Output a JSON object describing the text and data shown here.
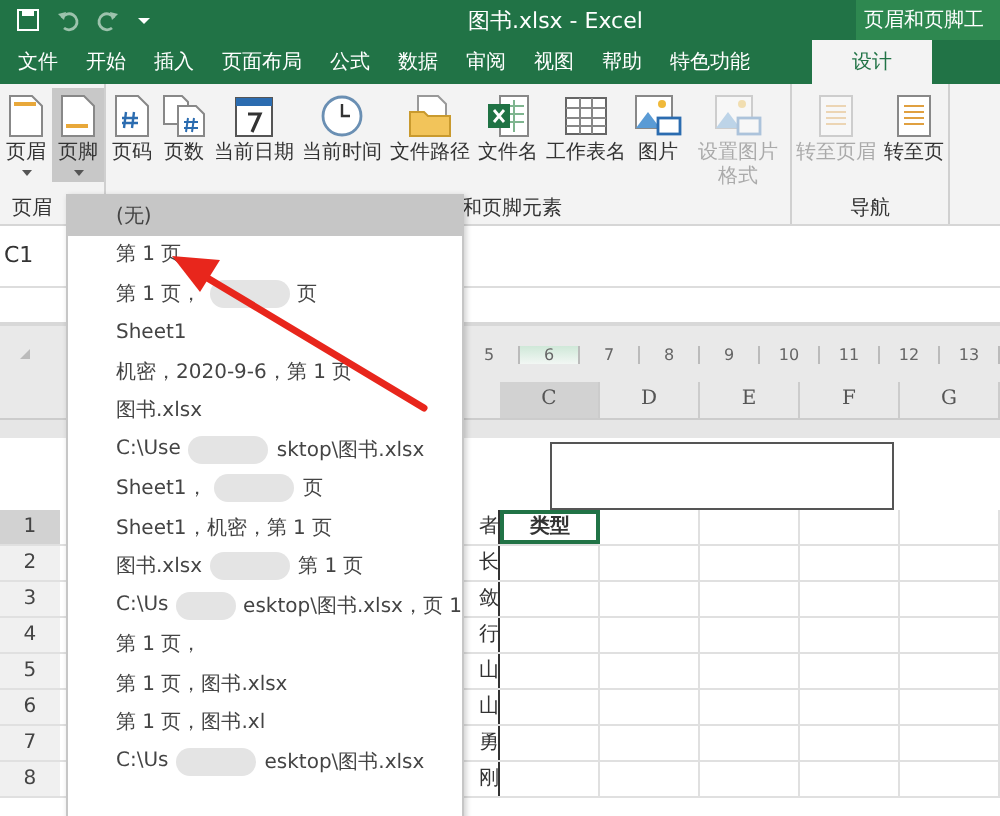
{
  "window": {
    "title": "图书.xlsx - Excel",
    "context_tab_group": "页眉和页脚工"
  },
  "tabs": [
    {
      "label": "文件",
      "selected": false
    },
    {
      "label": "开始",
      "selected": false
    },
    {
      "label": "插入",
      "selected": false
    },
    {
      "label": "页面布局",
      "selected": false
    },
    {
      "label": "公式",
      "selected": false
    },
    {
      "label": "数据",
      "selected": false
    },
    {
      "label": "审阅",
      "selected": false
    },
    {
      "label": "视图",
      "selected": false
    },
    {
      "label": "帮助",
      "selected": false
    },
    {
      "label": "特色功能",
      "selected": false
    },
    {
      "label": "设计",
      "selected": true
    }
  ],
  "ribbon": {
    "groups": [
      {
        "label": "页眉",
        "tools": [
          {
            "kind": "page",
            "label": "页眉",
            "pressed": false,
            "disabled": false
          },
          {
            "kind": "page",
            "label": "页脚",
            "pressed": true,
            "disabled": false
          }
        ]
      },
      {
        "label": "和页脚元素",
        "tools": [
          {
            "kind": "hash",
            "label": "页码",
            "pressed": false,
            "disabled": false
          },
          {
            "kind": "hashes",
            "label": "页数",
            "pressed": false,
            "disabled": false
          },
          {
            "kind": "calendar",
            "label": "当前日期",
            "pressed": false,
            "disabled": false
          },
          {
            "kind": "clock",
            "label": "当前时间",
            "pressed": false,
            "disabled": false
          },
          {
            "kind": "folder",
            "label": "文件路径",
            "pressed": false,
            "disabled": false
          },
          {
            "kind": "excel",
            "label": "文件名",
            "pressed": false,
            "disabled": false
          },
          {
            "kind": "grid",
            "label": "工作表名",
            "pressed": false,
            "disabled": false
          },
          {
            "kind": "picture",
            "label": "图片",
            "pressed": false,
            "disabled": false
          },
          {
            "kind": "picture",
            "label": "设置图片格式",
            "pressed": false,
            "disabled": true
          }
        ]
      },
      {
        "label": "导航",
        "tools": [
          {
            "kind": "doc",
            "label": "转至页眉",
            "pressed": false,
            "disabled": true
          },
          {
            "kind": "doc",
            "label": "转至页",
            "pressed": false,
            "disabled": false
          }
        ]
      }
    ]
  },
  "name_box": "C1",
  "ruler": [
    "5",
    "6",
    "7",
    "8",
    "9",
    "10",
    "11",
    "12",
    "13"
  ],
  "columns": [
    {
      "label": "C",
      "selected": true
    },
    {
      "label": "D",
      "selected": false
    },
    {
      "label": "E",
      "selected": false
    },
    {
      "label": "F",
      "selected": false
    },
    {
      "label": "G",
      "selected": false
    }
  ],
  "rows": [
    {
      "number": "1",
      "selected": true,
      "column_b": "者",
      "column_c": "类型"
    },
    {
      "number": "2",
      "selected": false,
      "column_b": "长",
      "column_c": ""
    },
    {
      "number": "3",
      "selected": false,
      "column_b": "敛",
      "column_c": ""
    },
    {
      "number": "4",
      "selected": false,
      "column_b": "行",
      "column_c": ""
    },
    {
      "number": "5",
      "selected": false,
      "column_b": "山",
      "column_c": ""
    },
    {
      "number": "6",
      "selected": false,
      "column_b": "山",
      "column_c": ""
    },
    {
      "number": "7",
      "selected": false,
      "column_b": "勇",
      "column_c": ""
    },
    {
      "number": "8",
      "selected": false,
      "column_b": "刚",
      "column_c": ""
    }
  ],
  "footer_menu": {
    "items": [
      {
        "selected": true,
        "texts": [
          "(无)"
        ]
      },
      {
        "selected": false,
        "texts": [
          "第 1 页"
        ]
      },
      {
        "selected": false,
        "texts": [
          "第 1 页，",
          "页"
        ]
      },
      {
        "selected": false,
        "texts": [
          "Sheet1"
        ]
      },
      {
        "selected": false,
        "texts": [
          "机密，2020-9-6，第 1 页"
        ]
      },
      {
        "selected": false,
        "texts": [
          "图书.xlsx"
        ]
      },
      {
        "selected": false,
        "texts": [
          "C:\\Use",
          "sktop\\图书.xlsx"
        ]
      },
      {
        "selected": false,
        "texts": [
          "Sheet1，",
          "页"
        ]
      },
      {
        "selected": false,
        "texts": [
          "Sheet1，机密，第 1 页"
        ]
      },
      {
        "selected": false,
        "texts": [
          "图书.xlsx",
          "第 1 页"
        ]
      },
      {
        "selected": false,
        "texts": [
          "C:\\Us",
          "esktop\\图书.xlsx，页 1"
        ]
      },
      {
        "selected": false,
        "texts": [
          "第 1 页，"
        ]
      },
      {
        "selected": false,
        "texts": [
          "第 1 页，图书.xlsx"
        ]
      },
      {
        "selected": false,
        "texts": [
          "第 1 页，图书.xl"
        ]
      },
      {
        "selected": false,
        "texts": [
          "C:\\Us",
          "esktop\\图书.xlsx"
        ]
      }
    ]
  }
}
